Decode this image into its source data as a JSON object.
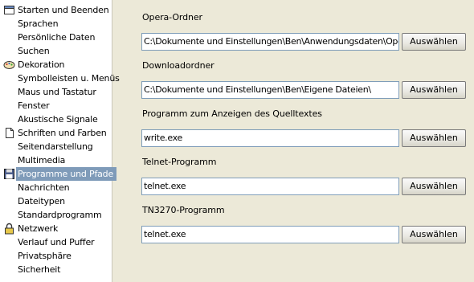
{
  "sidebar": {
    "items": [
      {
        "label": "Starten und Beenden",
        "icon": "window-icon"
      },
      {
        "label": "Sprachen"
      },
      {
        "label": "Persönliche Daten"
      },
      {
        "label": "Suchen"
      },
      {
        "label": "Dekoration",
        "icon": "palette-icon"
      },
      {
        "label": "Symbolleisten u. Menüs"
      },
      {
        "label": "Maus und Tastatur"
      },
      {
        "label": "Fenster"
      },
      {
        "label": "Akustische Signale"
      },
      {
        "label": "Schriften und Farben",
        "icon": "page-icon"
      },
      {
        "label": "Seitendarstellung"
      },
      {
        "label": "Multimedia"
      },
      {
        "label": "Programme und Pfade",
        "icon": "floppy-disk-icon",
        "selected": true
      },
      {
        "label": "Nachrichten"
      },
      {
        "label": "Dateitypen"
      },
      {
        "label": "Standardprogramm"
      },
      {
        "label": "Netzwerk",
        "icon": "lock-icon"
      },
      {
        "label": "Verlauf und Puffer"
      },
      {
        "label": "Privatsphäre"
      },
      {
        "label": "Sicherheit"
      }
    ],
    "selected_color": "#7f9bb9"
  },
  "main": {
    "sections": [
      {
        "label": "Opera-Ordner",
        "value": "C:\\Dokumente und Einstellungen\\Ben\\Anwendungsdaten\\Opera\\O",
        "button": "Auswählen"
      },
      {
        "label": "Downloadordner",
        "value": "C:\\Dokumente und Einstellungen\\Ben\\Eigene Dateien\\",
        "button": "Auswählen"
      },
      {
        "label": "Programm zum Anzeigen des Quelltextes",
        "value": "write.exe",
        "button": "Auswählen"
      },
      {
        "label": "Telnet-Programm",
        "value": "telnet.exe",
        "button": "Auswählen"
      },
      {
        "label": "TN3270-Programm",
        "value": "telnet.exe",
        "button": "Auswählen"
      }
    ]
  }
}
